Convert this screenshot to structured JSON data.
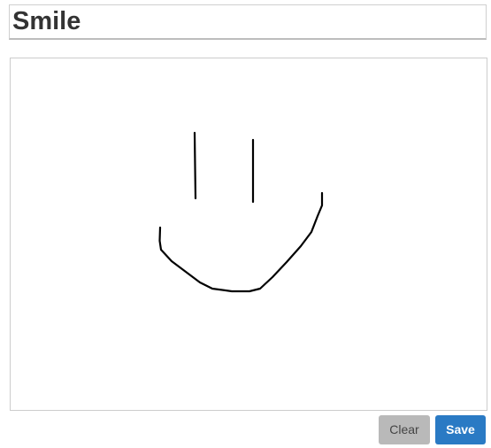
{
  "title": {
    "value": "Smile"
  },
  "drawing": {
    "stroke_color": "#000000"
  },
  "buttons": {
    "clear_label": "Clear",
    "save_label": "Save"
  },
  "colors": {
    "clear_bg": "#b9b9b9",
    "save_bg": "#2a7ac4"
  }
}
